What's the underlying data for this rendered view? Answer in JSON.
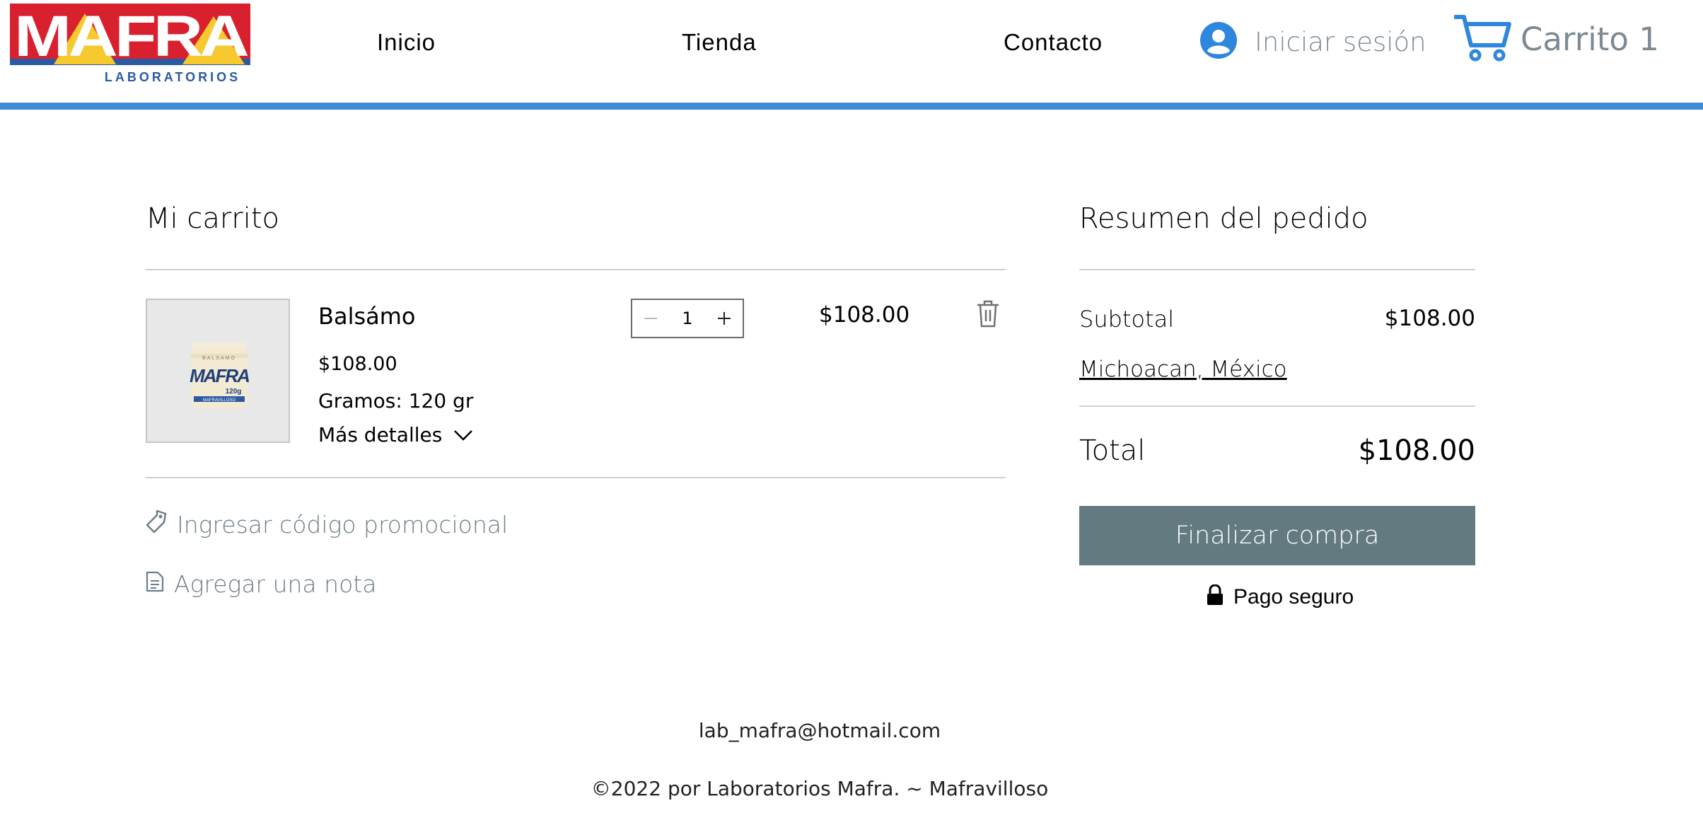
{
  "header": {
    "logo_text": "MAFRA",
    "logo_subtext": "LABORATORIOS",
    "nav": [
      "Inicio",
      "Tienda",
      "Contacto"
    ],
    "login_label": "Iniciar sesión",
    "cart_label": "Carrito",
    "cart_count": "1",
    "colors": {
      "accent": "#3d8cd4",
      "logo_red": "#d9202e",
      "logo_yellow": "#f6c92f",
      "logo_blue": "#2a5aa1"
    }
  },
  "cart": {
    "title": "Mi carrito",
    "items": [
      {
        "name": "Balsámo",
        "unit_price": "$108.00",
        "option": "Gramos: 120 gr",
        "details_label": "Más detalles",
        "quantity": "1",
        "line_total": "$108.00",
        "image_jar_label": "MAFRA",
        "image_jar_top": "BALSAMO",
        "image_jar_weight": "120g",
        "image_jar_bottom": "MAFRAVILLOSO"
      }
    ],
    "promo_label": "Ingresar código promocional",
    "note_label": "Agregar una nota"
  },
  "summary": {
    "title": "Resumen del pedido",
    "subtotal_label": "Subtotal",
    "subtotal_value": "$108.00",
    "location": "Michoacan, México",
    "total_label": "Total",
    "total_value": "$108.00",
    "checkout_label": "Finalizar compra",
    "secure_label": "Pago seguro",
    "button_color": "#627a80"
  },
  "footer": {
    "email": "lab_mafra@hotmail.com",
    "copyright": "©2022 por Laboratorios Mafra. ~ Mafravilloso"
  }
}
